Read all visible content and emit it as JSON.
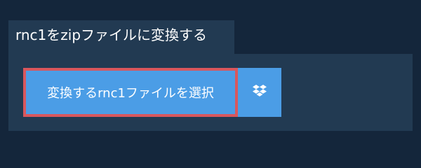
{
  "header": {
    "title": "rnc1をzipファイルに変換する"
  },
  "actions": {
    "select_file_label": "変換するrnc1ファイルを選択",
    "dropbox_icon": "dropbox-icon"
  },
  "colors": {
    "background": "#14263b",
    "panel": "#223a52",
    "button": "#4b9de6",
    "focus_border": "#d9575d",
    "text": "#ffffff"
  }
}
